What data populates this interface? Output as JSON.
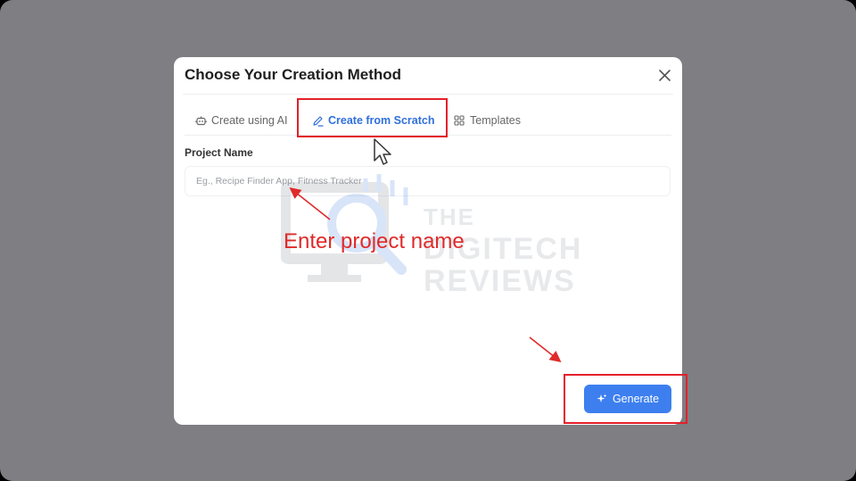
{
  "dialog": {
    "title": "Choose Your Creation Method",
    "close_icon": "close-icon"
  },
  "tabs": [
    {
      "label": "Create using AI",
      "icon": "robot-icon",
      "active": false
    },
    {
      "label": "Create from Scratch",
      "icon": "pencil-icon",
      "active": true
    },
    {
      "label": "Templates",
      "icon": "grid-icon",
      "active": false
    }
  ],
  "project_name": {
    "label": "Project Name",
    "placeholder": "Eg., Recipe Finder App, Fitness Tracker",
    "value": ""
  },
  "actions": {
    "generate_label": "Generate",
    "generate_icon": "sparkle-icon"
  },
  "annotations": {
    "enter_project_name": "Enter project name",
    "highlight_color": "#e4202a"
  },
  "watermark": {
    "line1": "THE",
    "line2": "DIGITECH",
    "line3": "REVIEWS"
  },
  "colors": {
    "accent": "#2f6fdc",
    "button": "#3d7fef",
    "backdrop": "#7f7e82"
  }
}
